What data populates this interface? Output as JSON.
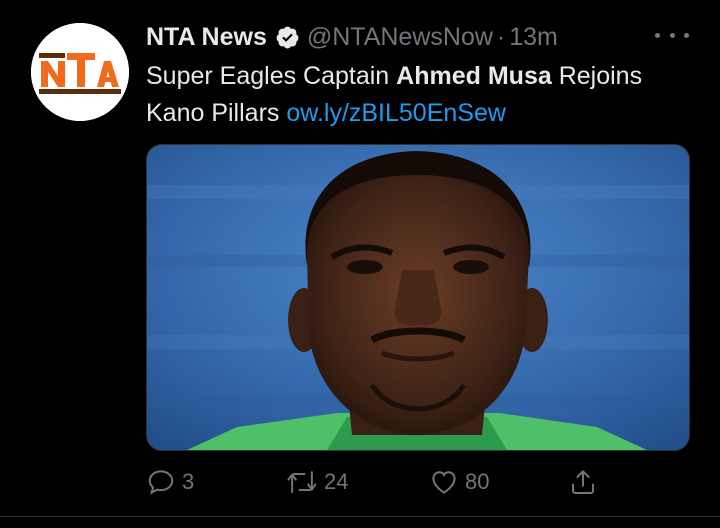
{
  "tweet": {
    "author": {
      "name": "NTA News",
      "handle": "@NTANewsNow",
      "separator": "·",
      "time": "13m",
      "avatar_logo_text": "NTA",
      "verified_icon": "verified-badge-icon"
    },
    "text": {
      "part1": "Super Eagles Captain ",
      "bold": "Ahmed Musa",
      "part2": " Rejoins Kano Pillars ",
      "link": "ow.ly/zBIL50EnSew"
    },
    "media": {
      "icon": "photo-icon"
    },
    "actions": {
      "replies": "3",
      "retweets": "24",
      "likes": "80"
    }
  },
  "colors": {
    "background": "#000000",
    "text": "#e7e9ea",
    "muted": "#71767b",
    "link": "#1d9bf0",
    "logo_orange": "#f26b1d",
    "logo_brown": "#5a2d0c"
  }
}
